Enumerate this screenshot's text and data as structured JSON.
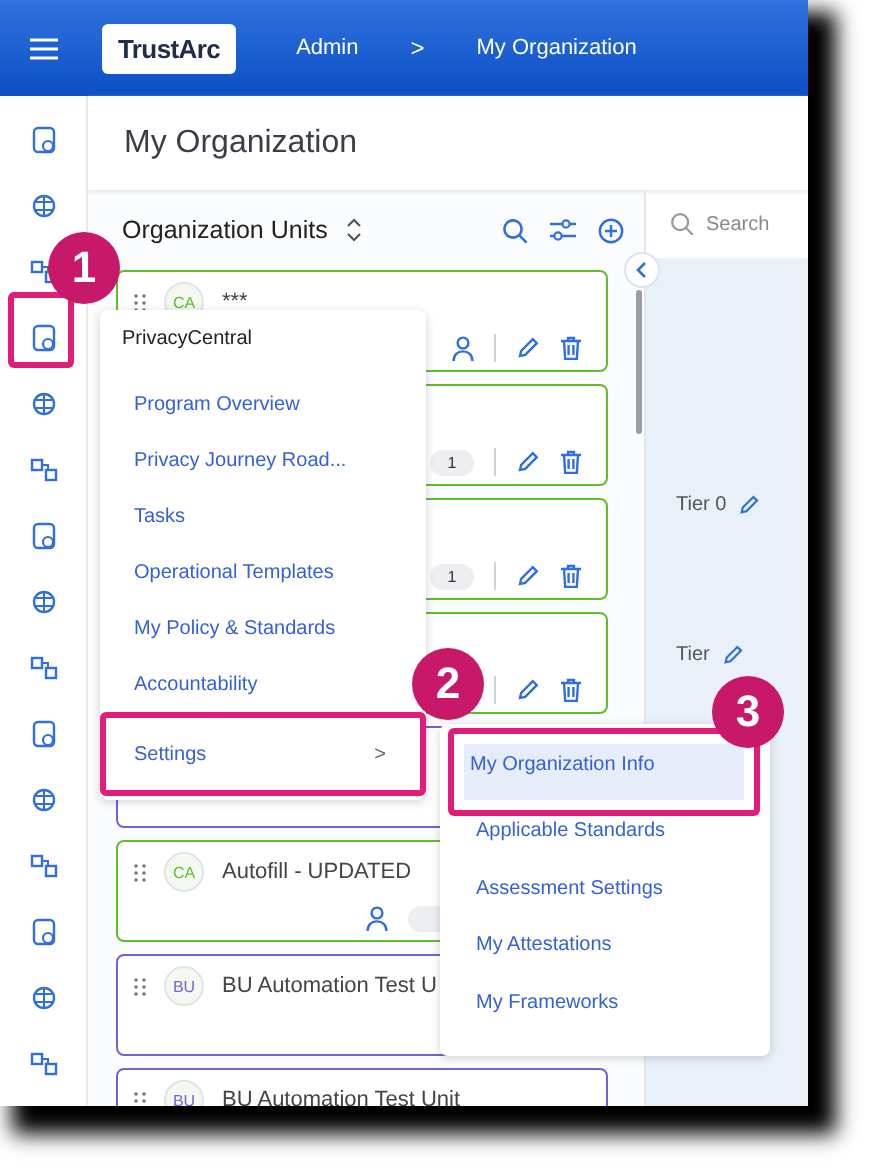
{
  "header": {
    "logo": "TrustArc",
    "breadcrumb": [
      "Admin",
      "My Organization"
    ],
    "separator": ">"
  },
  "page_title": "My Organization",
  "panel": {
    "title": "Organization Units"
  },
  "cards": [
    {
      "initials": "CA",
      "name": "***",
      "color": "#5cc02a",
      "owner": true,
      "badge": false,
      "actions": true
    },
    {
      "color": "#5cc02a",
      "owner": false,
      "badge": true,
      "count": "1",
      "actions": true
    },
    {
      "color": "#5cc02a",
      "owner": false,
      "badge": true,
      "count": "1",
      "actions": true
    },
    {
      "color": "#5cc02a",
      "owner": false,
      "badge": false,
      "actions": true
    },
    {
      "color": "#7a5fd4"
    },
    {
      "initials": "CA",
      "name": "Autofill - UPDATED",
      "color": "#5cc02a",
      "owner": true,
      "badge": true,
      "actions": false
    },
    {
      "initials": "BU",
      "name": "BU Automation Test U",
      "color": "#7a5fd4",
      "owner": false,
      "badge": false
    },
    {
      "initials": "BU",
      "name": "BU Automation Test Unit",
      "color": "#7a5fd4"
    }
  ],
  "right_panel": {
    "search": {
      "placeholder": "Search"
    },
    "tiers": [
      "Tier 0",
      "Tier"
    ]
  },
  "menu": {
    "title": "PrivacyCentral",
    "items": [
      {
        "label": "Program Overview",
        "submenu": false
      },
      {
        "label": "Privacy Journey Road...",
        "submenu": false
      },
      {
        "label": "Tasks",
        "submenu": false
      },
      {
        "label": "Operational Templates",
        "submenu": false
      },
      {
        "label": "My Policy & Standards",
        "submenu": false
      },
      {
        "label": "Accountability",
        "submenu": false
      },
      {
        "label": "Settings",
        "submenu": true,
        "chevron": ">"
      }
    ]
  },
  "submenu": {
    "items": [
      {
        "label": "My Organization Info",
        "selected": true
      },
      {
        "label": "Applicable Standards",
        "selected": false
      },
      {
        "label": "Assessment Settings",
        "selected": false
      },
      {
        "label": "My Attestations",
        "selected": false
      },
      {
        "label": "My Frameworks",
        "selected": false
      }
    ]
  },
  "callouts": [
    {
      "number": "1"
    },
    {
      "number": "2"
    },
    {
      "number": "3"
    }
  ]
}
